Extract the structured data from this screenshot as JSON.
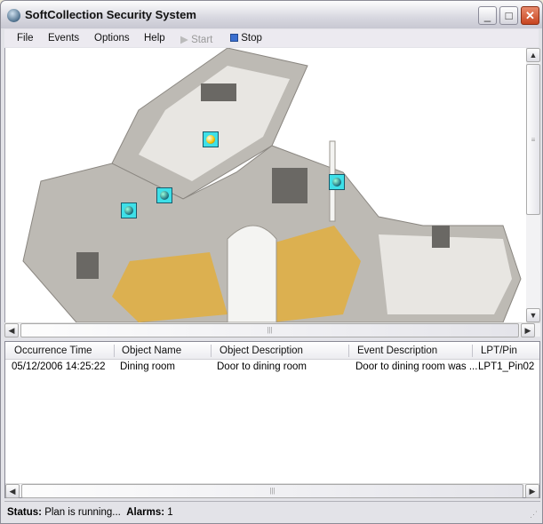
{
  "window": {
    "title": "SoftCollection Security System",
    "minimize": "_",
    "maximize": "□",
    "close": "✕"
  },
  "menu": {
    "file": "File",
    "events": "Events",
    "options": "Options",
    "help": "Help",
    "start": "Start",
    "stop": "Stop"
  },
  "plan": {
    "sensors": [
      {
        "name": "sensor-1",
        "state": "alarm"
      },
      {
        "name": "sensor-2",
        "state": "normal"
      },
      {
        "name": "sensor-3",
        "state": "normal"
      },
      {
        "name": "sensor-4",
        "state": "normal"
      }
    ]
  },
  "events": {
    "columns": [
      "Occurrence Time",
      "Object Name",
      "Object Description",
      "Event Description",
      "LPT/Pin"
    ],
    "rows": [
      [
        "05/12/2006 14:25:22",
        "Dining room",
        "Door to dining room",
        "Door to dining room was ...",
        "LPT1_Pin02"
      ]
    ]
  },
  "status": {
    "status_label": "Status:",
    "status_value": "Plan is running...",
    "alarms_label": "Alarms:",
    "alarms_value": "1"
  },
  "scroll": {
    "up": "▲",
    "down": "▼",
    "left": "◀",
    "right": "▶",
    "grip": "|||"
  }
}
